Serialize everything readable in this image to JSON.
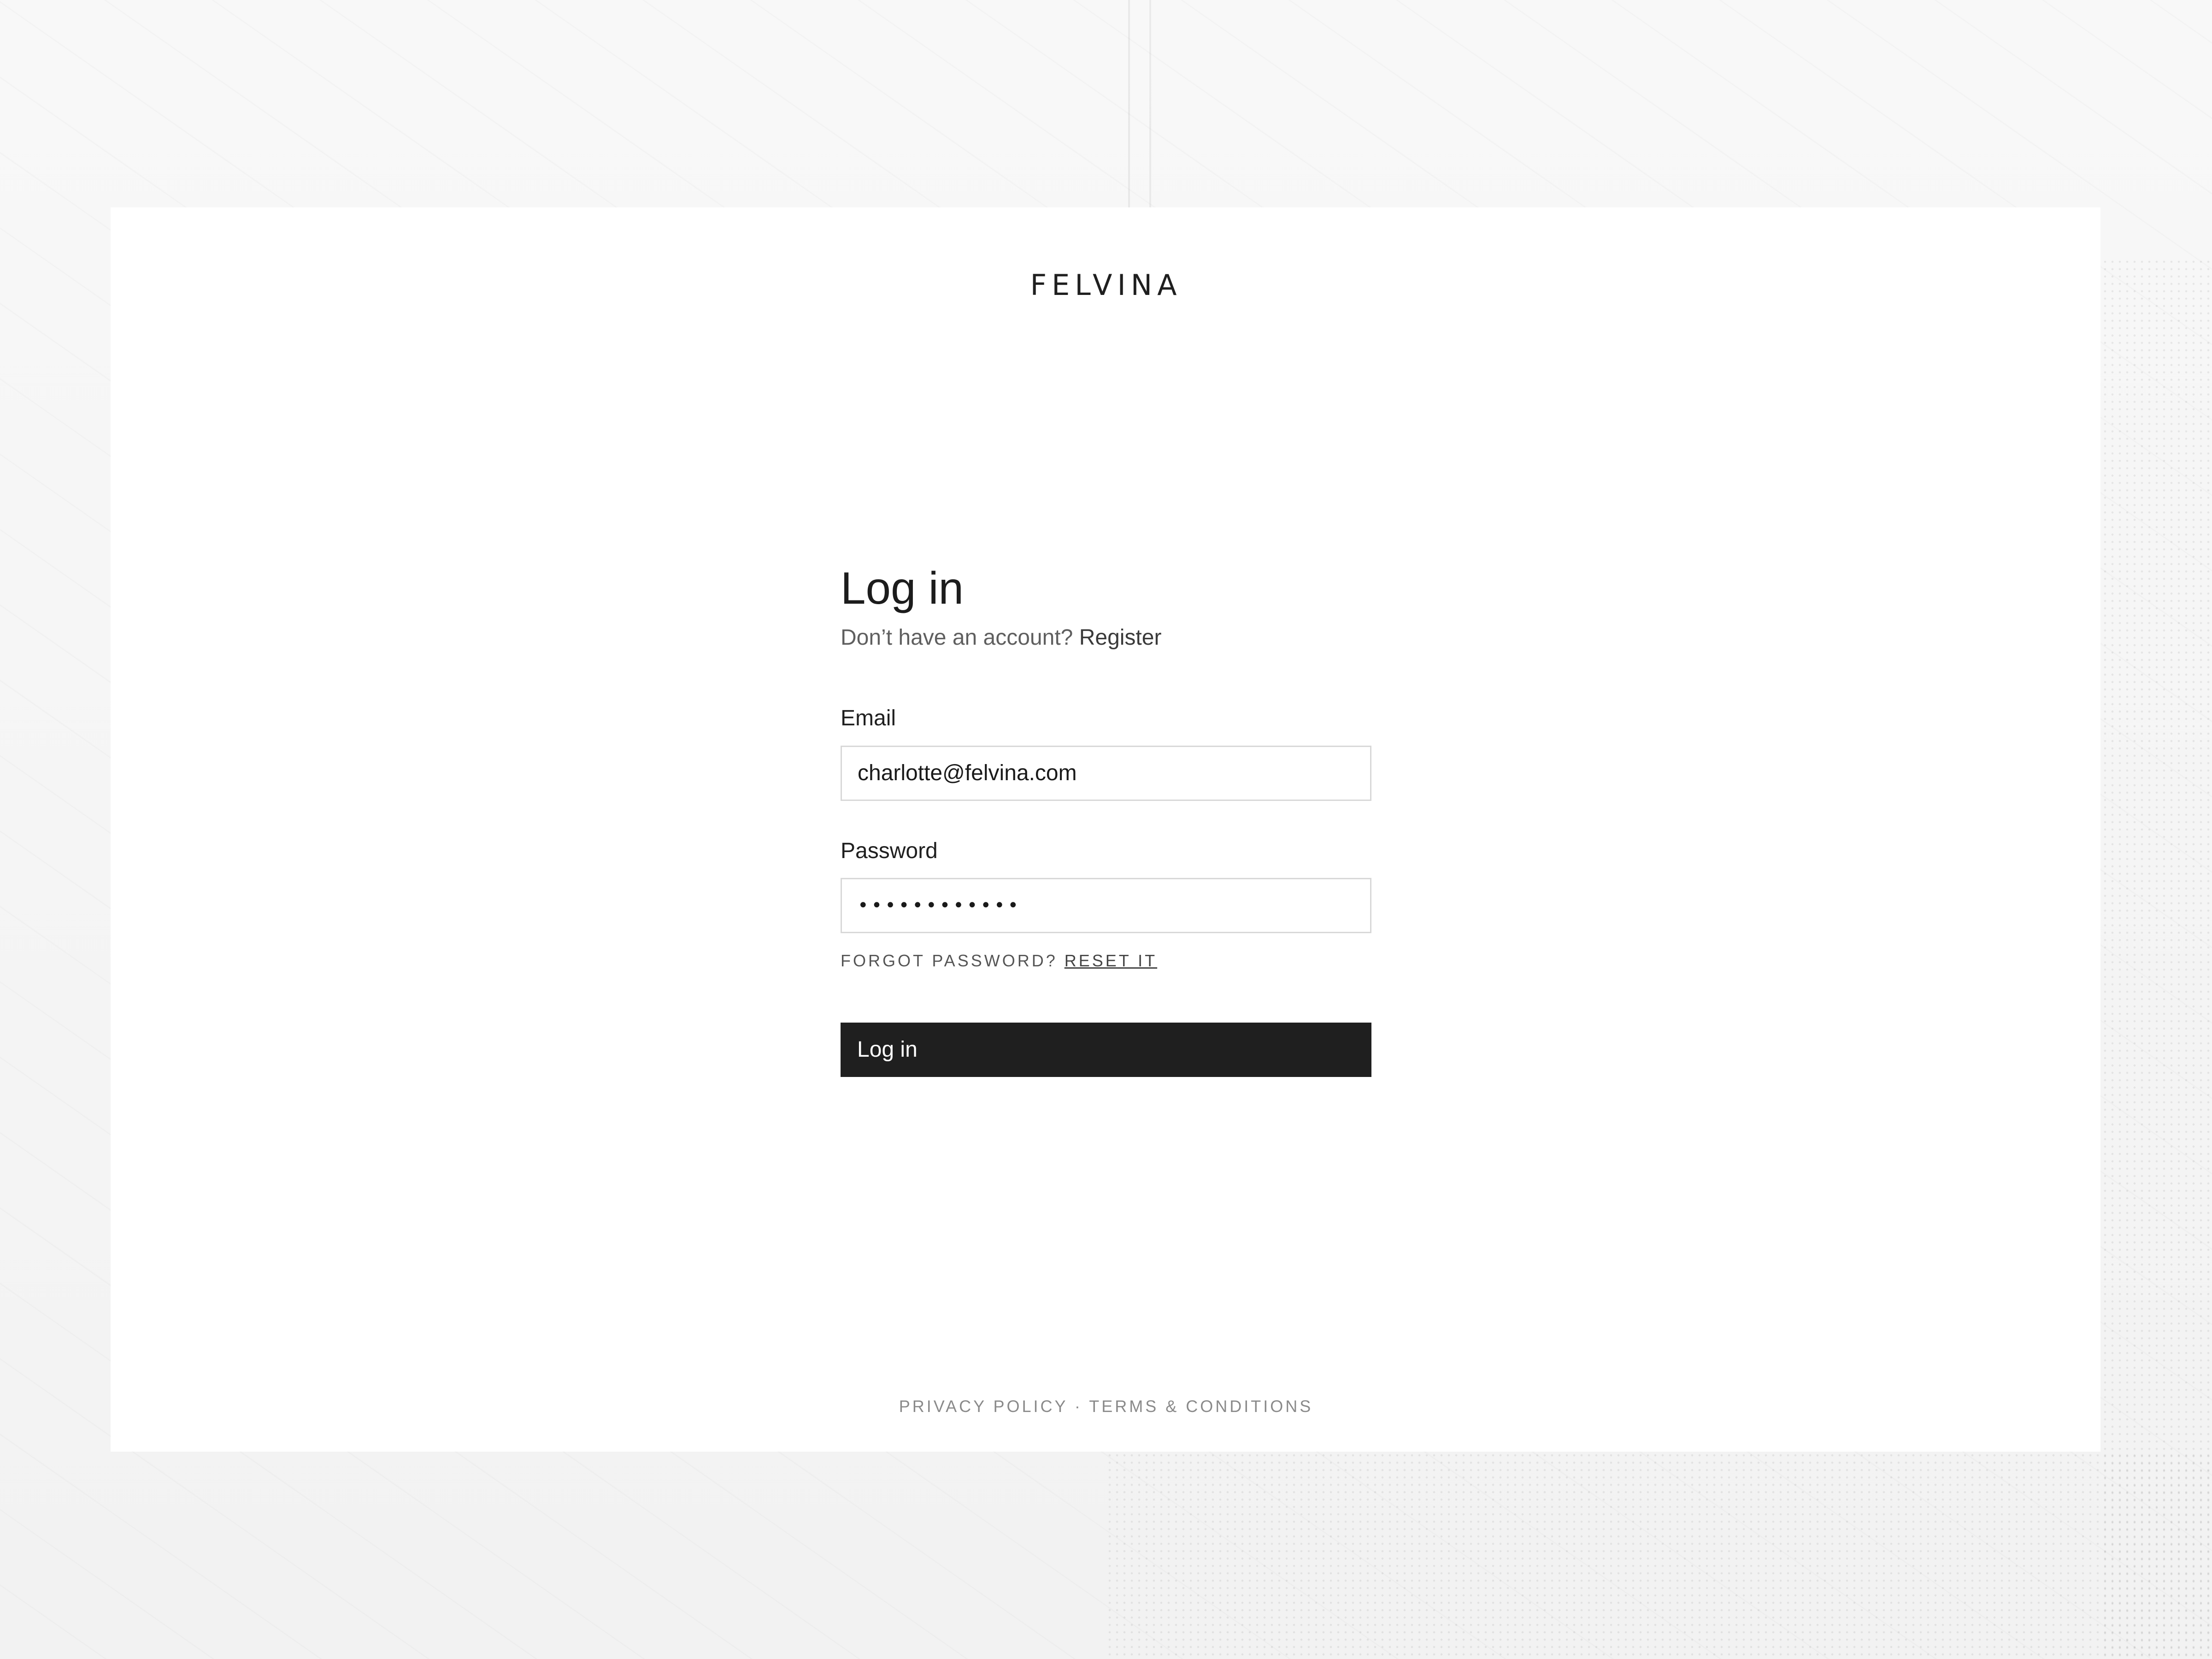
{
  "brand": {
    "name": "FELVINA"
  },
  "login": {
    "title": "Log in",
    "no_account_text": "Don’t have an account?",
    "register_label": "Register",
    "email_label": "Email",
    "email_value": "charlotte@felvina.com",
    "password_label": "Password",
    "password_value": "••••••••••••",
    "forgot_text": "FORGOT PASSWORD?",
    "reset_label": "RESET IT",
    "submit_label": "Log in"
  },
  "footer": {
    "privacy_label": "PRIVACY POLICY",
    "separator": "·",
    "terms_label": "TERMS & CONDITIONS"
  },
  "colors": {
    "button_background": "#1f1f1f",
    "button_text": "#ffffff",
    "input_border": "#d8d8d8",
    "page_background": "#f6f6f6",
    "card_background": "#ffffff"
  }
}
